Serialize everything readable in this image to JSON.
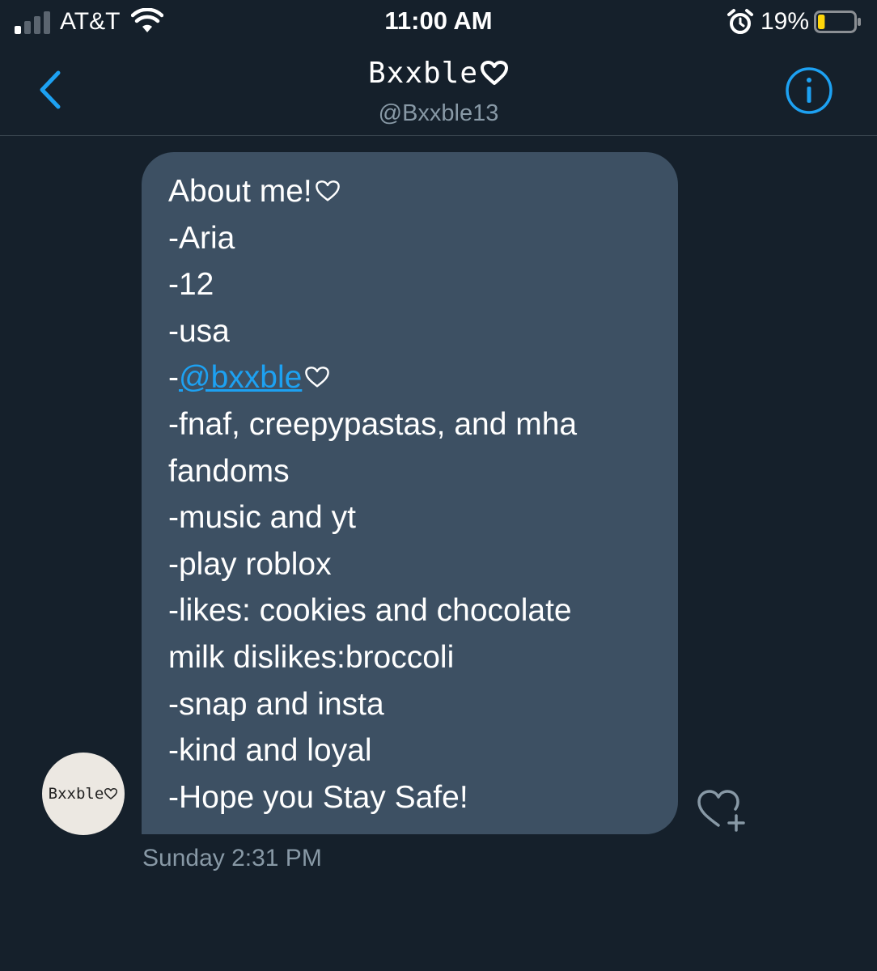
{
  "status_bar": {
    "carrier": "AT&T",
    "time": "11:00 AM",
    "battery_percent": "19%",
    "battery_level": 0.19,
    "signal_bars_active": 1,
    "icons": [
      "signal-icon",
      "wifi-icon",
      "alarm-icon",
      "battery-icon"
    ]
  },
  "header": {
    "title": "Bxxble",
    "handle": "@Bxxble13",
    "icons": [
      "back-chevron-icon",
      "heart-outline-icon",
      "info-icon"
    ]
  },
  "message": {
    "lines": [
      "About me!",
      "-Aria",
      "-12",
      "-usa",
      "-",
      "-fnaf, creepypastas, and mha",
      "fandoms",
      "-music and yt",
      "-play roblox",
      "-likes: cookies and chocolate",
      "milk dislikes:broccoli",
      "-snap and insta",
      "-kind and loyal",
      "-Hope you Stay Safe!"
    ],
    "mention": "@bxxble",
    "timestamp": "Sunday 2:31 PM",
    "avatar_text": "Bxxble",
    "like_icon": "heart-plus-icon"
  },
  "colors": {
    "background": "#15202b",
    "bubble": "#3d5063",
    "accent": "#1da1f2",
    "secondary_text": "#8899a6",
    "battery_low": "#ffd60a"
  }
}
